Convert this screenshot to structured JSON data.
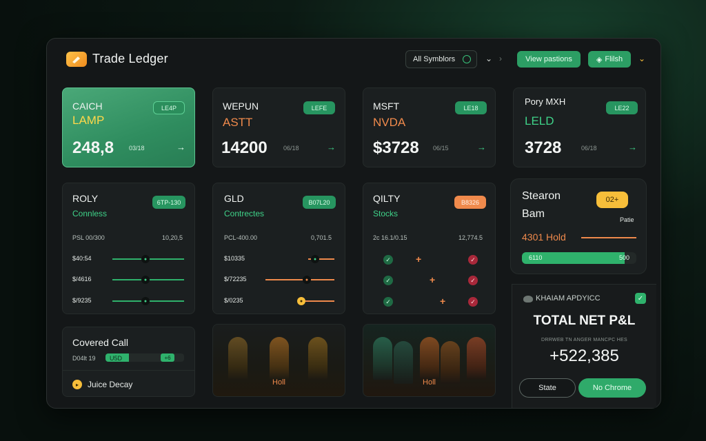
{
  "app": {
    "title": "Trade Ledger"
  },
  "toolbar": {
    "symbols_select": "All Symblors",
    "view_positions": "View pastions",
    "filter": "Flilsh"
  },
  "tickers": [
    {
      "label": "CAICH",
      "name": "LAMP",
      "value": "248,8",
      "small": "03/18",
      "badge": "LE4P",
      "accent": "#ffd84a",
      "arrow": "→"
    },
    {
      "label": "WEPUN",
      "name": "ASTT",
      "value": "14200",
      "small": "06/18",
      "badge": "LEFE",
      "accent": "#f08a4c",
      "arrow": "→"
    },
    {
      "label": "MSFT",
      "name": "NVDA",
      "value": "$3728",
      "small": "06/15",
      "badge": "LE18",
      "accent": "#f08a4c",
      "arrow": "→"
    },
    {
      "label": "Pory MXH",
      "name": "LELD",
      "value": "3728",
      "small": "06/18",
      "badge": "LE22",
      "accent": "#3fd389",
      "arrow": "→"
    }
  ],
  "mid_cards": [
    {
      "title": "ROLY",
      "subtitle": "Connless",
      "badge": "6TP-130",
      "header_left": "PSL 00/300",
      "header_right": "10,20,5",
      "rows": [
        {
          "label": "$40:54"
        },
        {
          "label": "$/4616"
        },
        {
          "label": "$/9235"
        }
      ]
    },
    {
      "title": "GLD",
      "subtitle": "Contrectes",
      "badge": "B07L20",
      "header_left": "PCL-400.00",
      "header_right": "0,701.5",
      "rows": [
        {
          "label": "$10335"
        },
        {
          "label": "$/72235"
        },
        {
          "label": "$/0235"
        }
      ]
    },
    {
      "title": "QILTY",
      "subtitle": "Stocks",
      "badge": "B8326",
      "header_left": "2c 16.1/0.15",
      "header_right": "12,774.5"
    }
  ],
  "side_card": {
    "title_line1": "Stearon",
    "title_line2": "Bam",
    "badge": "02+",
    "label": "Patie",
    "hold": "4301 Hold",
    "bar_left": "6110",
    "bar_right": "500",
    "bar_fill": 0.9
  },
  "covered_call": {
    "title": "Covered Call",
    "small_left": "D04lt 19",
    "pill": "U5D",
    "pill2": "+6",
    "juice": "Juice Decay",
    "bar_fill": 0.3
  },
  "bottom_boxes": [
    {
      "label": "Holl"
    },
    {
      "label": "Holl"
    }
  ],
  "pnl": {
    "header": "KHAIAM APDYICC",
    "title": "TOTAL NET P&L",
    "subheader": "DRRWEB TN ANGER MANCPC HES",
    "value": "+522,385",
    "btn_state": "State",
    "btn_no_chrome": "No Chrome"
  },
  "colors": {
    "green": "#2fb26c",
    "orange": "#f08a4c",
    "yellow": "#ffd84a",
    "red": "#a8283a"
  }
}
